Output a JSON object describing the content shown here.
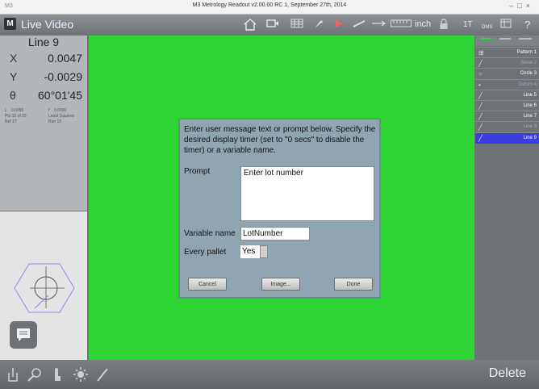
{
  "window": {
    "title": "M3 Metrology Readout  v2.00.00 RC 1, September 27th, 2014",
    "app_icon": "M3"
  },
  "toolbar": {
    "logo": "M",
    "mode": "Live Video",
    "units": "inch",
    "tool_1t": "1T",
    "tool_dms": "DMS",
    "help": "?"
  },
  "feature": {
    "name": "Line 9",
    "rows": [
      {
        "key": "X",
        "value": "0.0047"
      },
      {
        "key": "Y",
        "value": "-0.0029"
      },
      {
        "key": "θ",
        "value": "60°01'45"
      }
    ],
    "details": {
      "l_label": "L",
      "l_value": "0.0055",
      "f_label": "f",
      "f_value": "0.0000",
      "pts": "Pts 15 of 15",
      "method": "Least Squares",
      "ref": "Ref 1T",
      "run": "Run 15"
    }
  },
  "dialog": {
    "message": "Enter user message text or prompt below. Specify the desired display timer (set to \"0 secs\" to disable the timer) or a variable name.",
    "prompt_label": "Prompt",
    "prompt_value": "Enter lot number",
    "variable_label": "Variable name",
    "variable_value": "LotNumber",
    "pallet_label": "Every pallet",
    "pallet_value": "Yes",
    "cancel": "Cancel",
    "image": "Image...",
    "done": "Done"
  },
  "features_list": [
    {
      "name": "Pattern 1",
      "icon": "pattern-icon",
      "state": "normal"
    },
    {
      "name": "Skew 2",
      "icon": "line-icon",
      "state": "dim"
    },
    {
      "name": "Circle 3",
      "icon": "circle-icon",
      "state": "normal"
    },
    {
      "name": "Datum 4",
      "icon": "point-icon",
      "state": "dim"
    },
    {
      "name": "Line 5",
      "icon": "line-icon",
      "state": "normal"
    },
    {
      "name": "Line 6",
      "icon": "line-icon",
      "state": "normal"
    },
    {
      "name": "Line 7",
      "icon": "line-icon",
      "state": "normal"
    },
    {
      "name": "Line 8",
      "icon": "line-icon",
      "state": "dim"
    },
    {
      "name": "Line 9",
      "icon": "line-icon",
      "state": "selected"
    }
  ],
  "bottom": {
    "delete": "Delete"
  },
  "colors": {
    "video": "#2fd535",
    "selected": "#3b3fe0",
    "dialog": "#8fa6b1",
    "chrome": "#6d7276"
  }
}
